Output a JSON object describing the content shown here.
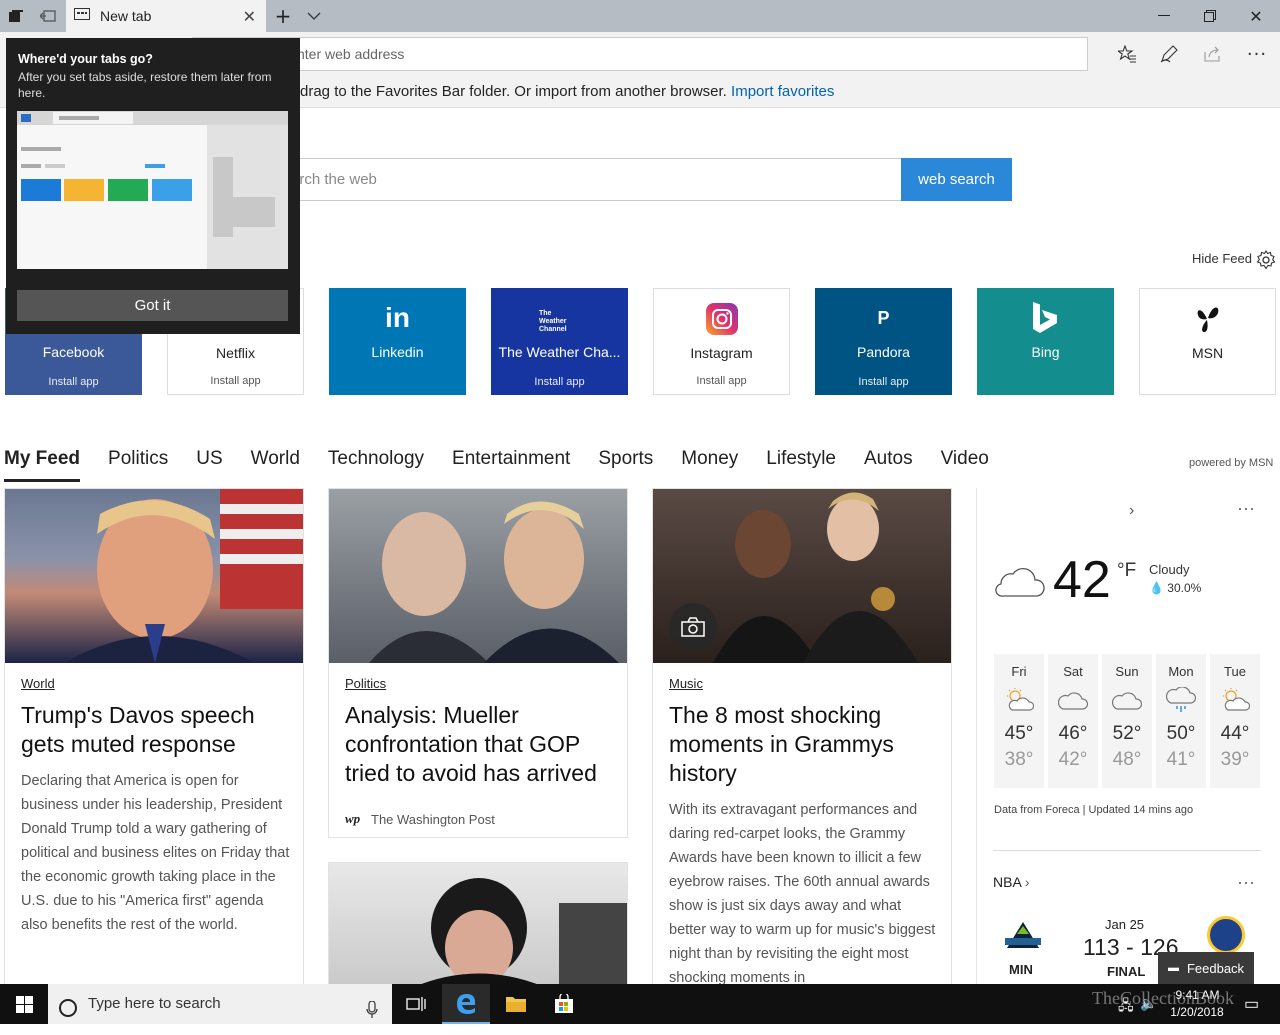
{
  "browser": {
    "tab_title": "New tab",
    "address_placeholder": "Search or enter web address",
    "address_visible": "nter web address"
  },
  "favorites_hint": {
    "text": "drag to the Favorites Bar folder. Or import from another browser.",
    "link": "Import favorites"
  },
  "popup": {
    "title": "Where'd your tabs go?",
    "description": "After you set tabs aside, restore them later from here.",
    "button": "Got it"
  },
  "web_search": {
    "placeholder": "arch the web",
    "button": "web search"
  },
  "feed_controls": {
    "hide_feed": "Hide Feed",
    "powered_by": "powered by MSN"
  },
  "tiles": [
    {
      "label": "Facebook",
      "install": "Install app",
      "bg": "#3b5998",
      "fg": "#ffffff",
      "logo": ""
    },
    {
      "label": "Netflix",
      "install": "Install app",
      "bg": "#ffffff",
      "fg": "#222222",
      "logo": ""
    },
    {
      "label": "Linkedin",
      "install": "",
      "bg": "#0077b5",
      "fg": "#ffffff",
      "logo": "in"
    },
    {
      "label": "The Weather Cha...",
      "install": "Install app",
      "bg": "#1735a1",
      "fg": "#ffffff",
      "logo": "The Weather Channel"
    },
    {
      "label": "Instagram",
      "install": "Install app",
      "bg": "#ffffff",
      "fg": "#222222",
      "logo": ""
    },
    {
      "label": "Pandora",
      "install": "Install app",
      "bg": "#005483",
      "fg": "#ffffff",
      "logo": "P"
    },
    {
      "label": "Bing",
      "install": "",
      "bg": "#138d8d",
      "fg": "#ffffff",
      "logo": "b"
    },
    {
      "label": "MSN",
      "install": "",
      "bg": "#ffffff",
      "fg": "#222222",
      "logo": ""
    }
  ],
  "feed_nav": [
    "My Feed",
    "Politics",
    "US",
    "World",
    "Technology",
    "Entertainment",
    "Sports",
    "Money",
    "Lifestyle",
    "Autos",
    "Video"
  ],
  "articles": [
    {
      "category": "World",
      "title": "Trump's Davos speech gets muted response",
      "body": "Declaring that America is open for business under his leadership, President Donald Trump told a wary gathering of political and business elites on Friday that the economic growth taking place in the U.S. due to his \"America first\" agenda also benefits the rest of the world."
    },
    {
      "category": "Politics",
      "title": "Analysis: Mueller confrontation that GOP tried to avoid has arrived",
      "source": "The Washington Post",
      "source_logo": "wp"
    },
    {
      "category": "Music",
      "title": "The 8 most shocking moments in Grammys history",
      "body": "With its extravagant performances and daring red-carpet looks, the Grammy Awards have been known to illicit a few eyebrow raises. The 60th annual awards show is just six days away and what better way to warm up for music's biggest night than by revisiting the eight most shocking moments in"
    }
  ],
  "weather": {
    "temp": "42",
    "unit": "°F",
    "condition": "Cloudy",
    "precip": "30.0%",
    "forecast": [
      {
        "day": "Fri",
        "hi": "45°",
        "lo": "38°",
        "icon": "partly-sunny-icon"
      },
      {
        "day": "Sat",
        "hi": "46°",
        "lo": "42°",
        "icon": "cloudy-icon"
      },
      {
        "day": "Sun",
        "hi": "52°",
        "lo": "48°",
        "icon": "cloudy-icon"
      },
      {
        "day": "Mon",
        "hi": "50°",
        "lo": "41°",
        "icon": "rain-icon"
      },
      {
        "day": "Tue",
        "hi": "44°",
        "lo": "39°",
        "icon": "partly-sunny-icon"
      }
    ],
    "footer": "Data from Foreca | Updated 14 mins ago"
  },
  "nba": {
    "label": "NBA",
    "date": "Jan 25",
    "score": "113 - 126",
    "status": "FINAL",
    "home_abbr": "MIN"
  },
  "feedback": "Feedback",
  "taskbar": {
    "search_placeholder": "Type here to search",
    "time": "9:41 AM",
    "date": "1/20/2018",
    "watermark": "TheCollectionBook"
  }
}
